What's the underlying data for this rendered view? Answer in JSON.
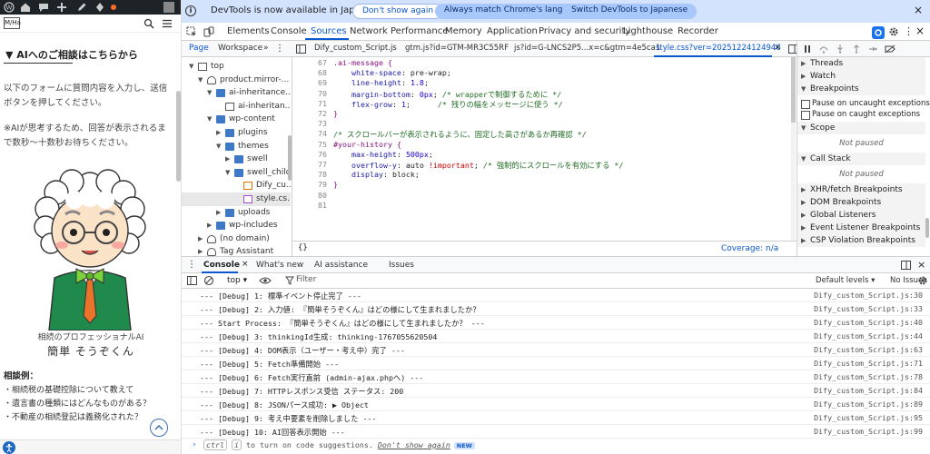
{
  "site": {
    "logo_text": "M/Ha",
    "section_title": "▼ AIへのご相談はこちらから",
    "intro_text_1": "以下のフォームに質問内容を入力し、送信ボタンを押してください。",
    "intro_text_2": "※AIが思考するため、回答が表示されるまで数秒〜十数秒お待ちください。",
    "char_subtitle": "相続のプロフェッショナルAI",
    "char_name": "簡単 そうぞくん",
    "examples_head": "相談例：",
    "examples": [
      "・相続税の基礎控除について教えて",
      "・遺言書の種類にはどんなものがある？",
      "・不動産の相続登記は義務化された？"
    ]
  },
  "banner": {
    "message": "DevTools is now available in Japanese",
    "btn_dont_show": "Don't show again",
    "btn_always_match": "Always match Chrome's language",
    "btn_switch": "Switch DevTools to Japanese",
    "close": "×"
  },
  "tabs": [
    "Elements",
    "Console",
    "Sources",
    "Network",
    "Performance",
    "Memory",
    "Application",
    "Privacy and security",
    "Lighthouse",
    "Recorder"
  ],
  "sources": {
    "subtabs": [
      "Page",
      "Workspace",
      "»"
    ],
    "file_tabs": [
      "Dify_custom_Script.js",
      "gtm.js?id=GTM-MR3C55RF",
      "js?id=G-LNCS2P5...x=c&gtm=4e5ca1",
      "style.css?ver=20251224124946"
    ],
    "tree": [
      {
        "label": "top",
        "type": "frame",
        "level": 0,
        "arrow": "▼"
      },
      {
        "label": "product.mirror-...",
        "type": "cloud",
        "level": 1,
        "arrow": "▼"
      },
      {
        "label": "ai-inheritance...",
        "type": "folder",
        "level": 2,
        "arrow": "▼"
      },
      {
        "label": "ai-inheritan...",
        "type": "file",
        "level": 3,
        "arrow": ""
      },
      {
        "label": "wp-content",
        "type": "folder",
        "level": 2,
        "arrow": "▼"
      },
      {
        "label": "plugins",
        "type": "folder",
        "level": 3,
        "arrow": "▶"
      },
      {
        "label": "themes",
        "type": "folder",
        "level": 3,
        "arrow": "▼"
      },
      {
        "label": "swell",
        "type": "folder",
        "level": 4,
        "arrow": "▶"
      },
      {
        "label": "swell_child",
        "type": "folder",
        "level": 4,
        "arrow": "▼"
      },
      {
        "label": "Dify_cu...",
        "type": "js",
        "level": 5,
        "arrow": ""
      },
      {
        "label": "style.cs...",
        "type": "css",
        "level": 5,
        "arrow": "",
        "selected": true
      },
      {
        "label": "uploads",
        "type": "folder",
        "level": 3,
        "arrow": "▶"
      },
      {
        "label": "wp-includes",
        "type": "folder",
        "level": 2,
        "arrow": "▶"
      },
      {
        "label": "(no domain)",
        "type": "cloud",
        "level": 1,
        "arrow": "▶"
      },
      {
        "label": "Tag Assistant",
        "type": "cloud",
        "level": 1,
        "arrow": "▶"
      }
    ],
    "code": [
      {
        "n": "67",
        "t": [
          {
            "c": "c-sel",
            "s": ".ai-message {"
          }
        ]
      },
      {
        "n": "68",
        "t": [
          {
            "c": "c-prop",
            "s": "    white-space"
          },
          {
            "c": "c-val",
            "s": ": pre-wrap;"
          }
        ]
      },
      {
        "n": "69",
        "t": [
          {
            "c": "c-prop",
            "s": "    line-height"
          },
          {
            "c": "c-val",
            "s": ": "
          },
          {
            "c": "c-num",
            "s": "1.8"
          },
          {
            "c": "c-val",
            "s": ";"
          }
        ]
      },
      {
        "n": "70",
        "t": [
          {
            "c": "c-prop",
            "s": "    margin-bottom"
          },
          {
            "c": "c-val",
            "s": ": "
          },
          {
            "c": "c-num",
            "s": "0px"
          },
          {
            "c": "c-val",
            "s": "; "
          },
          {
            "c": "c-com",
            "s": "/* wrapperで制御するために */"
          }
        ]
      },
      {
        "n": "71",
        "t": [
          {
            "c": "c-prop",
            "s": "    flex-grow"
          },
          {
            "c": "c-val",
            "s": ": "
          },
          {
            "c": "c-num",
            "s": "1"
          },
          {
            "c": "c-val",
            "s": ";      "
          },
          {
            "c": "c-com",
            "s": "/* 残りの幅をメッセージに使う */"
          }
        ]
      },
      {
        "n": "72",
        "t": [
          {
            "c": "c-sel",
            "s": "}"
          }
        ]
      },
      {
        "n": "73",
        "t": []
      },
      {
        "n": "74",
        "t": [
          {
            "c": "c-com",
            "s": "/* スクロールバーが表示されるように、固定した高さがあるか再確認 */"
          }
        ]
      },
      {
        "n": "75",
        "t": [
          {
            "c": "c-sel",
            "s": "#your-history {"
          }
        ]
      },
      {
        "n": "76",
        "t": [
          {
            "c": "c-prop",
            "s": "    max-height"
          },
          {
            "c": "c-val",
            "s": ": "
          },
          {
            "c": "c-num",
            "s": "500px"
          },
          {
            "c": "c-val",
            "s": ";"
          }
        ]
      },
      {
        "n": "77",
        "t": [
          {
            "c": "c-prop",
            "s": "    overflow-y"
          },
          {
            "c": "c-val",
            "s": ": auto "
          },
          {
            "c": "c-imp",
            "s": "!important"
          },
          {
            "c": "c-val",
            "s": "; "
          },
          {
            "c": "c-com",
            "s": "/* 強制的にスクロールを有効にする */"
          }
        ]
      },
      {
        "n": "78",
        "t": [
          {
            "c": "c-prop",
            "s": "    display"
          },
          {
            "c": "c-val",
            "s": ": block;"
          }
        ]
      },
      {
        "n": "79",
        "t": [
          {
            "c": "c-sel",
            "s": "}"
          }
        ]
      },
      {
        "n": "80",
        "t": []
      },
      {
        "n": "81",
        "t": []
      }
    ],
    "pretty_print": "{}",
    "coverage": "Coverage: n/a"
  },
  "debugger": {
    "sections": {
      "threads": "Threads",
      "watch": "Watch",
      "breakpoints": "Breakpoints",
      "pause_uncaught": "Pause on uncaught exceptions",
      "pause_caught": "Pause on caught exceptions",
      "scope": "Scope",
      "not_paused_1": "Not paused",
      "call_stack": "Call Stack",
      "not_paused_2": "Not paused",
      "xhr": "XHR/fetch Breakpoints",
      "dom": "DOM Breakpoints",
      "global": "Global Listeners",
      "event": "Event Listener Breakpoints",
      "csp": "CSP Violation Breakpoints"
    }
  },
  "drawer": {
    "tabs": [
      "Console",
      "What's new",
      "AI assistance",
      "Issues"
    ],
    "context": "top ▾",
    "filter_placeholder": "Filter",
    "levels": "Default levels ▾",
    "issues": "No Issues",
    "logs": [
      {
        "msg": "--- [Debug] 1: 標準イベント停止完了 ---",
        "src": "Dify_custom_Script.js:30"
      },
      {
        "msg": "--- [Debug] 2: 入力値: 『簡単そうぞくん』はどの様にして生まれましたか？",
        "src": "Dify_custom_Script.js:33"
      },
      {
        "msg": "--- Start Process: 『簡単そうぞくん』はどの様にして生まれましたか？ ---",
        "src": "Dify_custom_Script.js:40"
      },
      {
        "msg": "--- [Debug] 3: thinkingId生成: thinking-1767055620504",
        "src": "Dify_custom_Script.js:44"
      },
      {
        "msg": "--- [Debug] 4: DOM表示（ユーザー・考え中）完了 ---",
        "src": "Dify_custom_Script.js:63"
      },
      {
        "msg": "--- [Debug] 5: Fetch準備開始 ---",
        "src": "Dify_custom_Script.js:71"
      },
      {
        "msg": "--- [Debug] 6: Fetch実行直前 (admin-ajax.phpへ) ---",
        "src": "Dify_custom_Script.js:78"
      },
      {
        "msg": "--- [Debug] 7: HTTPレスポンス受信 ステータス: 200",
        "src": "Dify_custom_Script.js:84"
      },
      {
        "msg": "--- [Debug] 8: JSONパース成功: ",
        "obj": "▶ Object",
        "src": "Dify_custom_Script.js:89"
      },
      {
        "msg": "--- [Debug] 9: 考え中要素を削除しました ---",
        "src": "Dify_custom_Script.js:95"
      },
      {
        "msg": "--- [Debug] 10: AI回答表示開始 ---",
        "src": "Dify_custom_Script.js:99"
      }
    ],
    "prompt": {
      "arrow": "›",
      "ctrl": "ctrl",
      "i": "i",
      "hint_mid": " to turn on code suggestions. ",
      "dont_show": "Don't show again",
      "new_badge": "NEW"
    }
  },
  "colors": {
    "accent": "#0b57d0",
    "banner_bg": "#d3e3fd",
    "admin_bar": "#1d2327"
  }
}
